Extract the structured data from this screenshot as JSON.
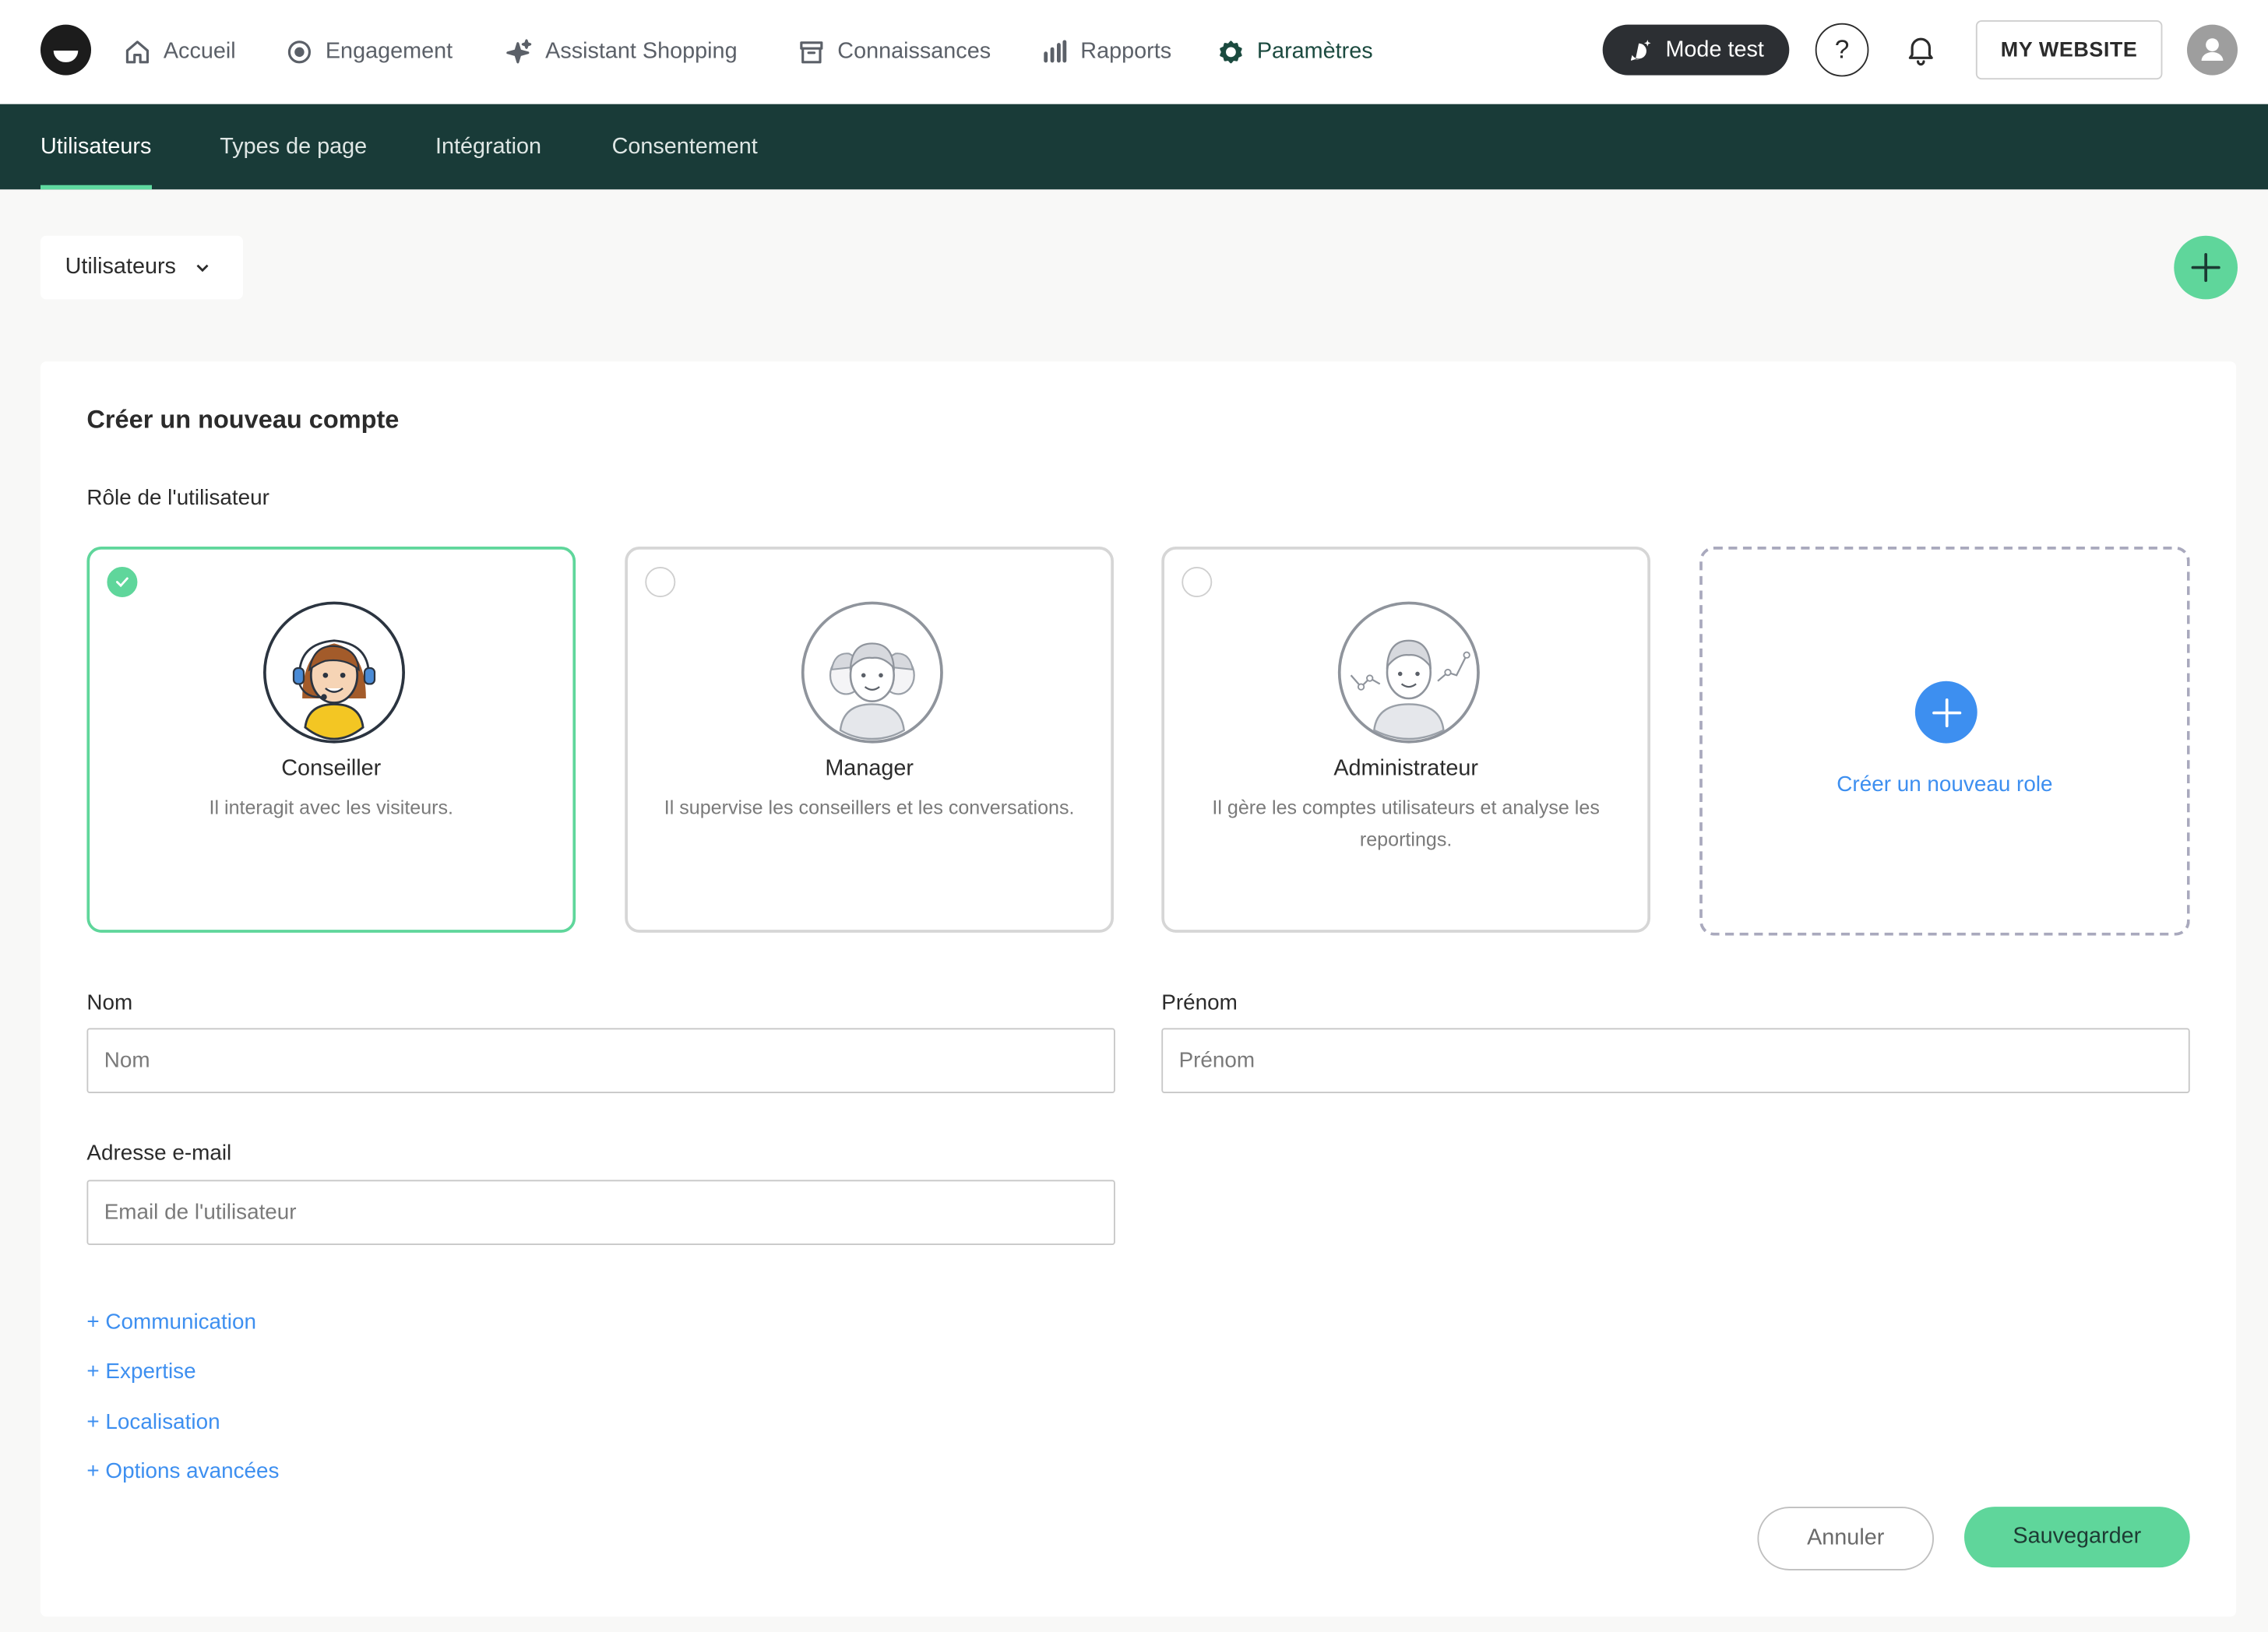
{
  "topnav": {
    "items": [
      {
        "label": "Accueil",
        "icon": "home-icon"
      },
      {
        "label": "Engagement",
        "icon": "target-icon"
      },
      {
        "label": "Assistant Shopping",
        "icon": "sparkle-icon"
      },
      {
        "label": "Connaissances",
        "icon": "archive-icon"
      },
      {
        "label": "Rapports",
        "icon": "bar-chart-icon"
      },
      {
        "label": "Paramètres",
        "icon": "gear-icon"
      }
    ],
    "mode_test_label": "Mode test",
    "help_label": "?",
    "website_label": "MY WEBSITE"
  },
  "subnav": {
    "tabs": [
      "Utilisateurs",
      "Types de page",
      "Intégration",
      "Consentement"
    ]
  },
  "toolbar": {
    "dropdown_label": "Utilisateurs"
  },
  "form": {
    "title": "Créer un nouveau compte",
    "role_label": "Rôle de l'utilisateur",
    "roles": [
      {
        "name": "Conseiller",
        "desc": "Il interagit avec les visiteurs.",
        "selected": true
      },
      {
        "name": "Manager",
        "desc": "Il supervise les conseillers et les conversations.",
        "selected": false
      },
      {
        "name": "Administrateur",
        "desc": "Il gère les comptes utilisateurs et analyse les reportings.",
        "selected": false
      }
    ],
    "new_role_label": "Créer un nouveau role",
    "nom_label": "Nom",
    "nom_placeholder": "Nom",
    "prenom_label": "Prénom",
    "prenom_placeholder": "Prénom",
    "email_label": "Adresse e-mail",
    "email_placeholder": "Email de l'utilisateur",
    "expanders": [
      "+ Communication",
      "+ Expertise",
      "+ Localisation",
      "+ Options avancées"
    ],
    "cancel_label": "Annuler",
    "save_label": "Sauvegarder"
  },
  "colors": {
    "accent_green": "#5fd69b",
    "subnav_bg": "#193b38",
    "link_blue": "#3d8ff0"
  }
}
